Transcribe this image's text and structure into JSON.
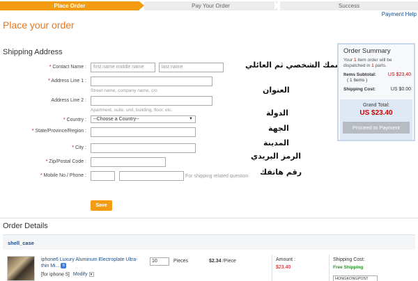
{
  "steps": [
    "Place Order",
    "Pay Your Order",
    "Success"
  ],
  "payment_help": "Payment Help",
  "page_title": "Place your order",
  "shipping": {
    "title": "Shipping Address",
    "contact_label": "Contact Name :",
    "contact_first_placeholder": "first name middle name",
    "contact_last_placeholder": "last name",
    "address1_label": "Address Line 1 :",
    "address1_hint": "Street name, company name, c/o",
    "address2_label": "Address Line 2 :",
    "address2_hint": "Apartment, suite, unit, building, floor, etc.",
    "country_label": "Country :",
    "country_value": "--Choose a Country--",
    "state_label": "State/Province/Region :",
    "city_label": "City :",
    "zip_label": "Zip/Postal Code :",
    "mobile_label": "Mobile No./ Phone :",
    "mobile_hint": "For shipping related question",
    "save_label": "Save"
  },
  "annotations": {
    "name": "اسمك الشخصي ثم العائلي",
    "address": "العنوان",
    "country": "الدولة",
    "region": "الجهة",
    "city": "المدينة",
    "zip": "الرمز البريدي",
    "phone": "رقم هاتفك"
  },
  "summary": {
    "title": "Order Summary",
    "desc_pre": "Your ",
    "desc_count": "1",
    "desc_mid": " item order will be dispatched in ",
    "desc_parts": "1",
    "desc_post": " parts.",
    "subtotal_label": "Items Subtotal:",
    "subtotal_items": "( 1 Items )",
    "subtotal_value": "US $23.40",
    "shipping_label": "Shipping Cost:",
    "shipping_value": "US $0.00",
    "grand_label": "Grand Total:",
    "grand_value": "US $23.40",
    "proceed_label": "Proceed to Payment"
  },
  "details": {
    "title": "Order Details",
    "store": "shell_case",
    "product_title": "iphone6 Luxury Aluminum Electroplate Ultra-thin Mi...",
    "badge": "6",
    "variant": "[for iphone 5]",
    "modify": "Modify",
    "quantity": "10",
    "unit": "Pieces",
    "price": "$2.34",
    "price_unit": " /Piece",
    "amount_label": "Amount :",
    "amount_value": "$23.40",
    "shipping_cost_label": "Shipping Cost:",
    "shipping_cost_value": "Free Shipping",
    "shipping_method": "HONGKONGPOST"
  }
}
